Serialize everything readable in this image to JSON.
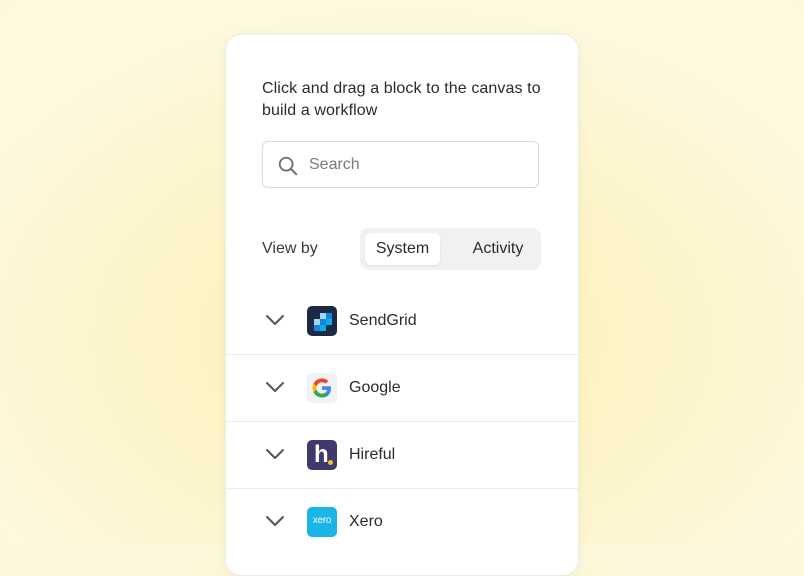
{
  "panel": {
    "instruction": "Click and drag a block to the canvas to build a workflow"
  },
  "search": {
    "placeholder": "Search",
    "value": ""
  },
  "view_by": {
    "label": "View by",
    "options": [
      "System",
      "Activity"
    ],
    "selected": "System"
  },
  "systems": [
    {
      "name": "SendGrid",
      "icon": "sendgrid-logo"
    },
    {
      "name": "Google",
      "icon": "google-logo"
    },
    {
      "name": "Hireful",
      "icon": "hireful-logo"
    },
    {
      "name": "Xero",
      "icon": "xero-logo",
      "logo_text": "xero"
    }
  ],
  "colors": {
    "background": "#fcf3c2",
    "sendgrid": "#1a2a44",
    "hireful": "#3f3a6e",
    "xero": "#1ab4e8"
  }
}
